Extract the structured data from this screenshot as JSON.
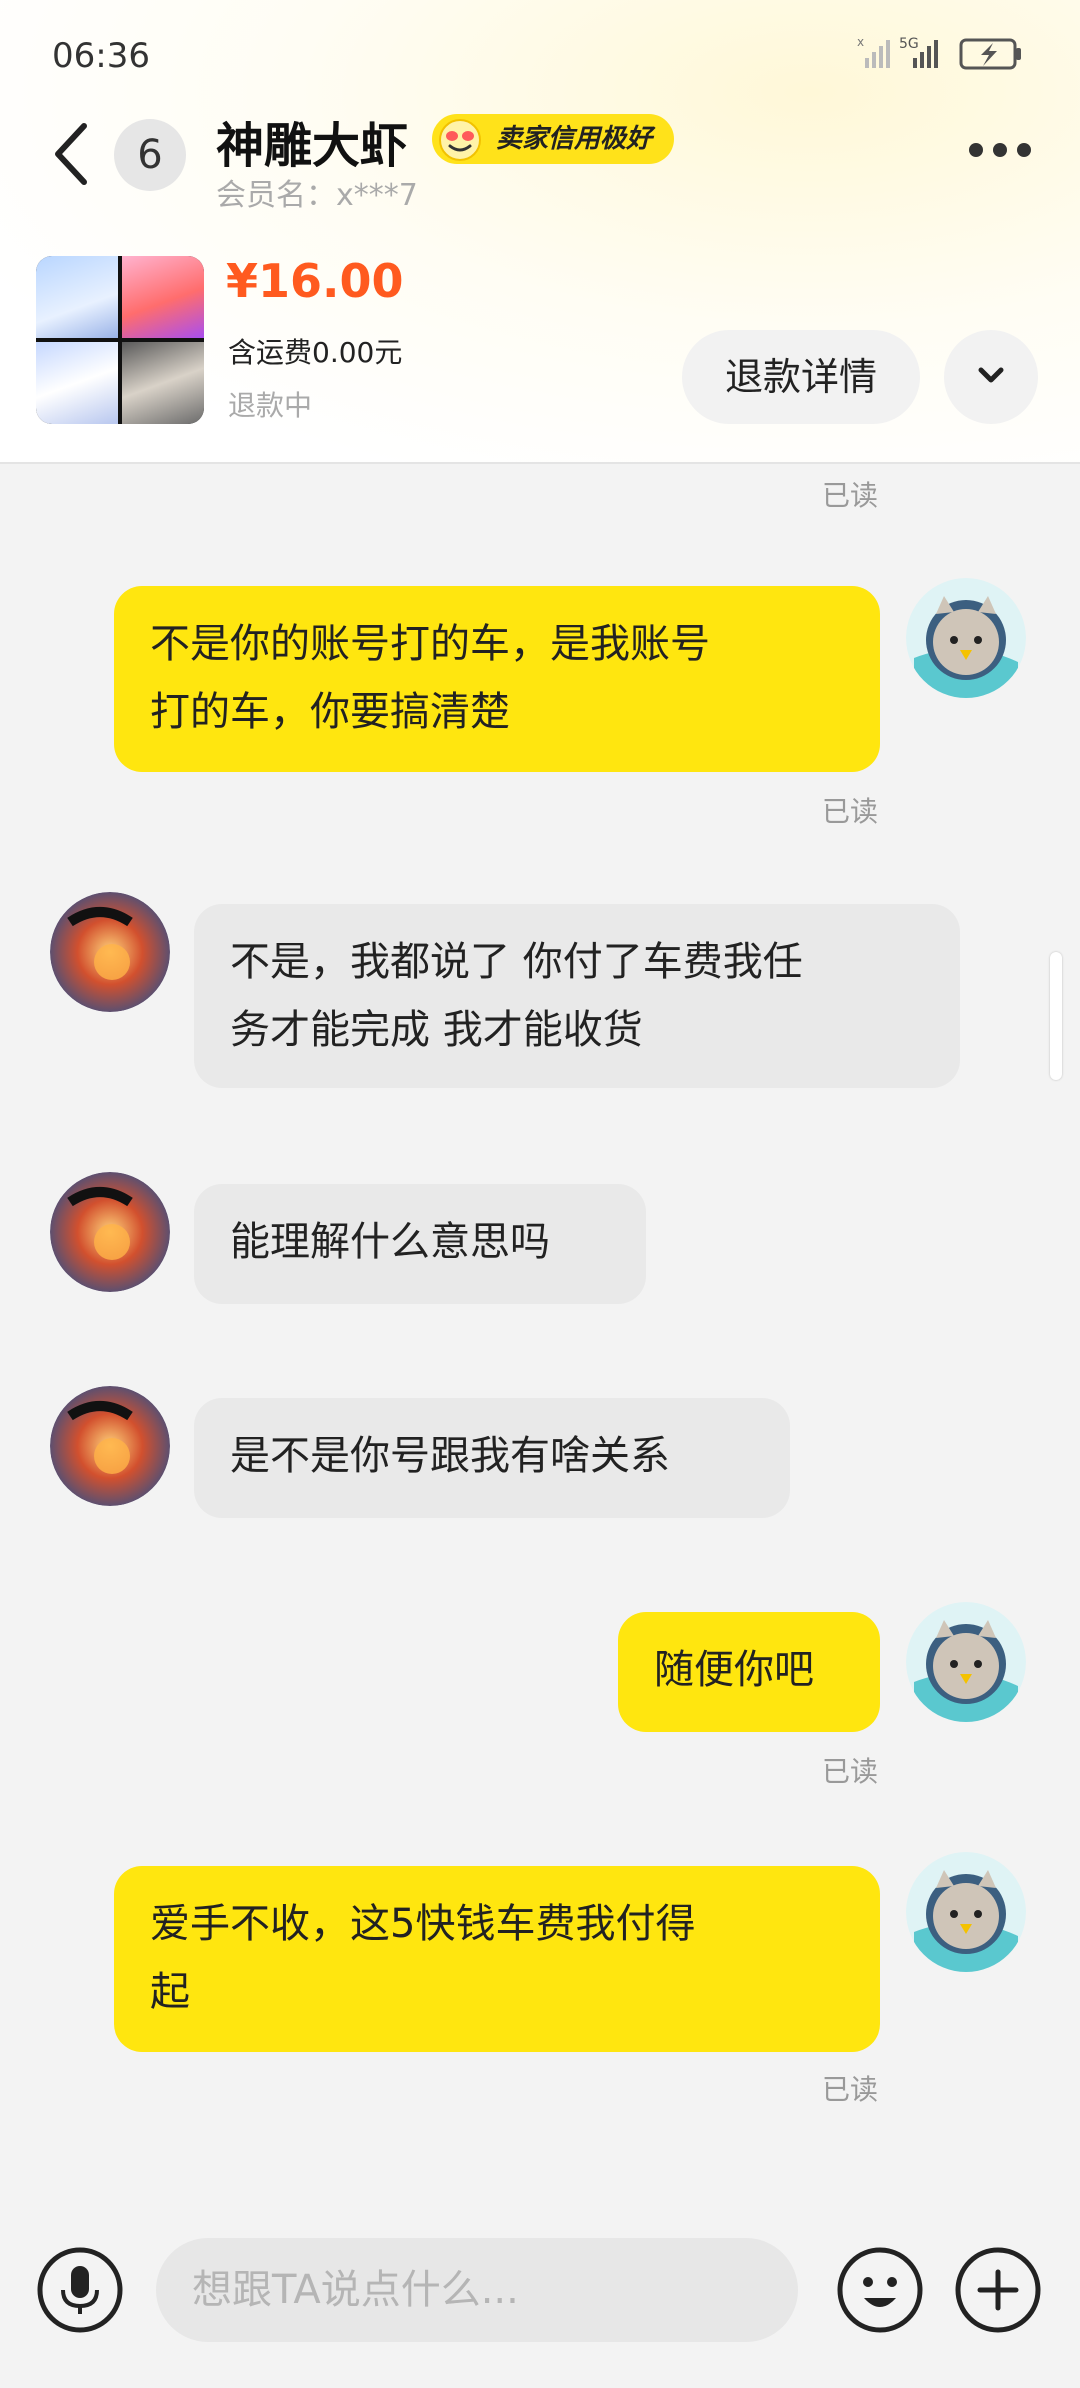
{
  "status_bar": {
    "time": "06:36",
    "network": "5G"
  },
  "header": {
    "unread_count": "6",
    "seller_name": "神雕大虾",
    "credit_badge": "卖家信用极好",
    "member_label": "会员名：x***7"
  },
  "product": {
    "price": "¥16.00",
    "shipping": "含运费0.00元",
    "status": "退款中",
    "refund_button": "退款详情"
  },
  "messages": [
    {
      "side": "me",
      "read": "已读"
    },
    {
      "side": "me",
      "text_line1": "不是你的账号打的车，是我账号",
      "text_line2": "打的车，你要搞清楚",
      "read": "已读"
    },
    {
      "side": "them",
      "text_line1": "不是，我都说了 你付了车费我任",
      "text_line2": "务才能完成 我才能收货"
    },
    {
      "side": "them",
      "text": "能理解什么意思吗"
    },
    {
      "side": "them",
      "text": "是不是你号跟我有啥关系"
    },
    {
      "side": "me",
      "text": "随便你吧",
      "read": "已读"
    },
    {
      "side": "me",
      "text_line1": "爱手不收，这5快钱车费我付得",
      "text_line2": "起",
      "read": "已读"
    }
  ],
  "composer": {
    "placeholder": "想跟TA说点什么..."
  },
  "colors": {
    "accent_yellow": "#ffe60f",
    "price_orange": "#ff5a1f"
  }
}
